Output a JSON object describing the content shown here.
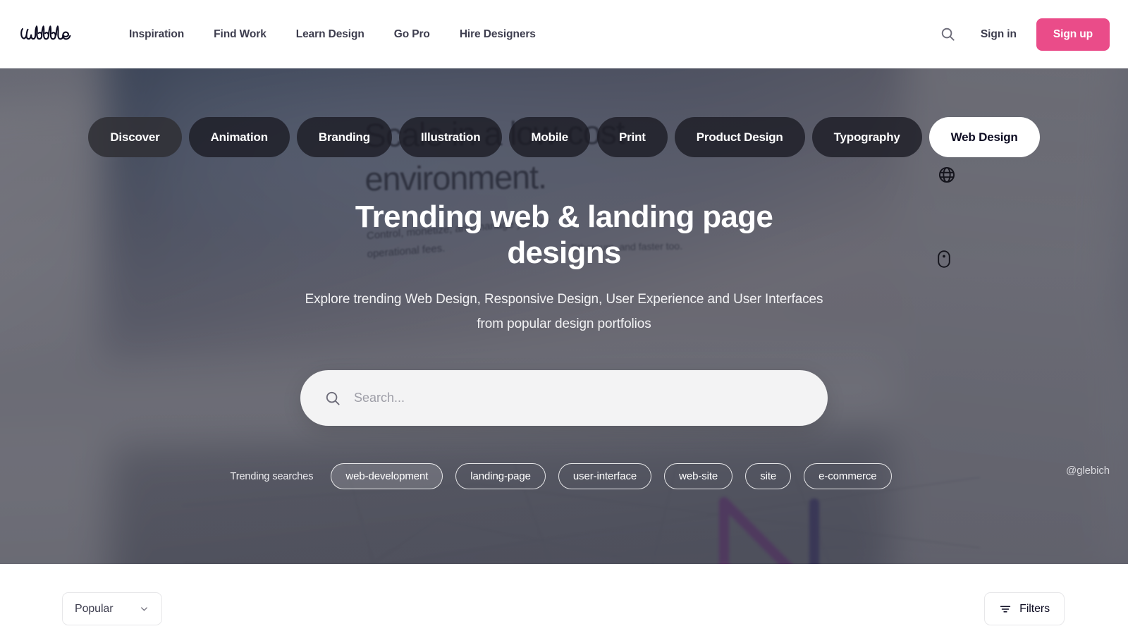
{
  "nav": {
    "logo_alt": "dribbble",
    "links": [
      {
        "label": "Inspiration"
      },
      {
        "label": "Find Work"
      },
      {
        "label": "Learn Design"
      },
      {
        "label": "Go Pro"
      },
      {
        "label": "Hire Designers"
      }
    ],
    "search_icon": "search-icon",
    "sign_in": "Sign in",
    "sign_up": "Sign up",
    "accent_color": "#ea4c89"
  },
  "hero": {
    "categories": [
      {
        "label": "Discover",
        "active": false
      },
      {
        "label": "Animation",
        "active": false
      },
      {
        "label": "Branding",
        "active": false
      },
      {
        "label": "Illustration",
        "active": false
      },
      {
        "label": "Mobile",
        "active": false
      },
      {
        "label": "Print",
        "active": false
      },
      {
        "label": "Product Design",
        "active": false
      },
      {
        "label": "Typography",
        "active": false
      },
      {
        "label": "Web Design",
        "active": true
      }
    ],
    "deco_icons": [
      {
        "name": "globe-icon"
      },
      {
        "name": "mouse-icon"
      }
    ],
    "title": "Trending web & landing page designs",
    "subtitle": "Explore trending Web Design, Responsive Design, User Experience and User Interfaces from popular design portfolios",
    "search": {
      "icon": "search-icon",
      "value": "",
      "placeholder": "Search..."
    },
    "trending": {
      "label": "Trending searches",
      "tags": [
        {
          "label": "web-development",
          "solid": true
        },
        {
          "label": "landing-page",
          "solid": false
        },
        {
          "label": "user-interface",
          "solid": false
        },
        {
          "label": "web-site",
          "solid": false
        },
        {
          "label": "site",
          "solid": false
        },
        {
          "label": "e-commerce",
          "solid": false
        }
      ]
    },
    "credit": "@glebich",
    "background_text": {
      "headline": "Scale in a low-cost\nenvironment.",
      "body": "Control, monetize, and manage your IP\noperational fees.",
      "body2": "Ethereum, and faster too."
    }
  },
  "toolbar": {
    "sort_label": "Popular",
    "sort_icon": "chevron-down-icon",
    "filters_label": "Filters",
    "filters_icon": "filter-icon"
  }
}
